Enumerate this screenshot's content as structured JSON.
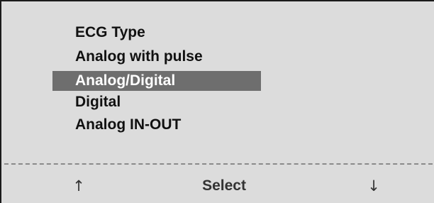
{
  "menu": {
    "title": "ECG Type",
    "items": [
      {
        "label": "Analog with pulse",
        "selected": false
      },
      {
        "label": "Analog/Digital",
        "selected": true
      },
      {
        "label": "Digital",
        "selected": false
      },
      {
        "label": "Analog IN-OUT",
        "selected": false
      }
    ]
  },
  "softkeys": {
    "up": {
      "label": "↑",
      "icon": "arrow-up-icon"
    },
    "select": {
      "label": "Select"
    },
    "down": {
      "label": "↓",
      "icon": "arrow-down-icon"
    }
  },
  "colors": {
    "background": "#dcdcdc",
    "highlight": "#6e6e6e",
    "highlight_text": "#ffffff",
    "text": "#111111"
  }
}
